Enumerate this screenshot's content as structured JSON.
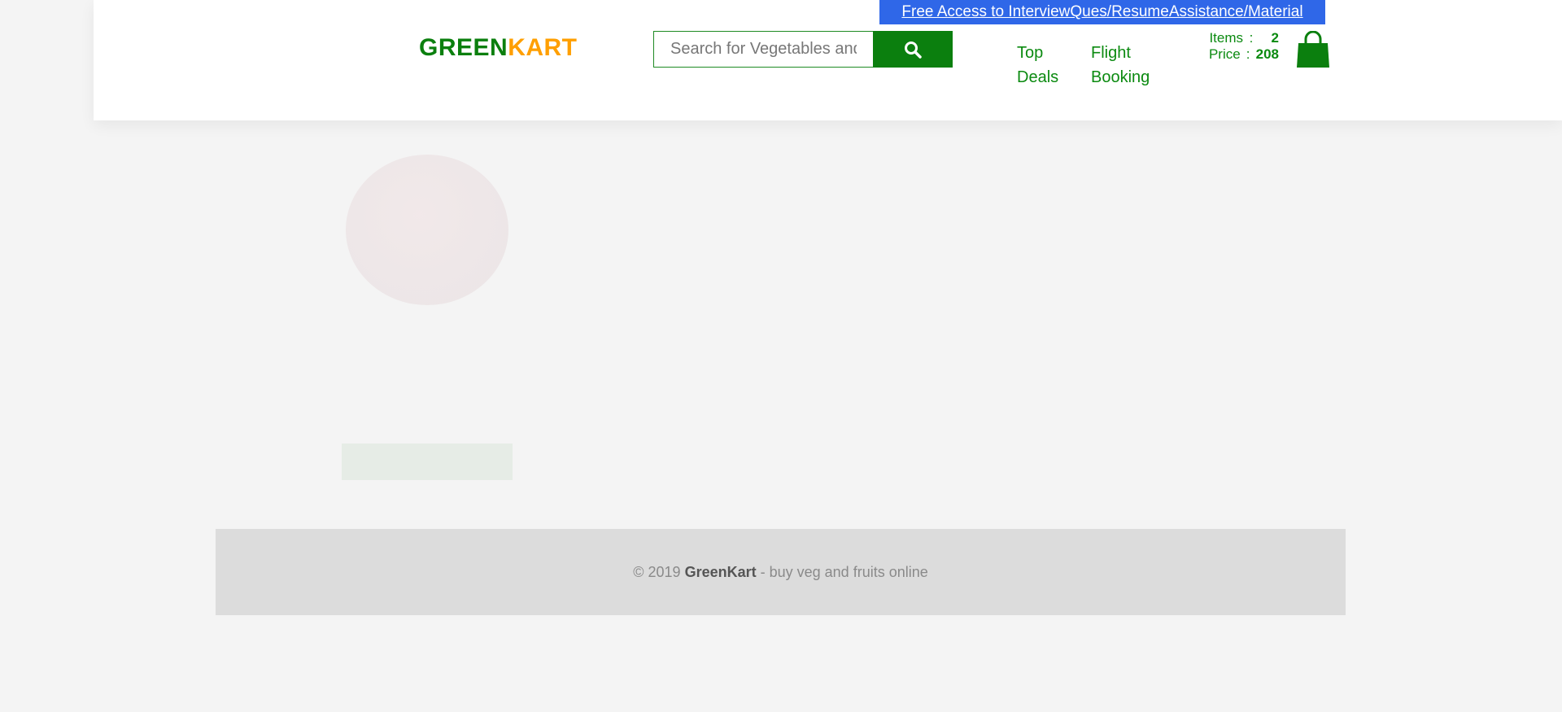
{
  "promo": {
    "text": "Free Access to InterviewQues/ResumeAssistance/Material"
  },
  "logo": {
    "part1": "GREEN",
    "part2": "KART"
  },
  "search": {
    "placeholder": "Search for Vegetables and Fruits",
    "value": "",
    "button_icon": "search-icon"
  },
  "nav": [
    {
      "label": "Top Deals"
    },
    {
      "label": "Flight Booking"
    }
  ],
  "cart": {
    "items_label": "Items",
    "items_value": "2",
    "price_label": "Price",
    "price_value": "208",
    "separator": ":",
    "icon": "shopping-bag-icon"
  },
  "colors": {
    "brand_green": "#0b7f0e",
    "brand_orange": "#ff9f00",
    "promo_blue": "#2f67e8",
    "footer_bg": "#dcdcdc"
  },
  "footer": {
    "prefix": "© 2019",
    "brand": "GreenKart",
    "suffix": "- buy veg and fruits online"
  }
}
